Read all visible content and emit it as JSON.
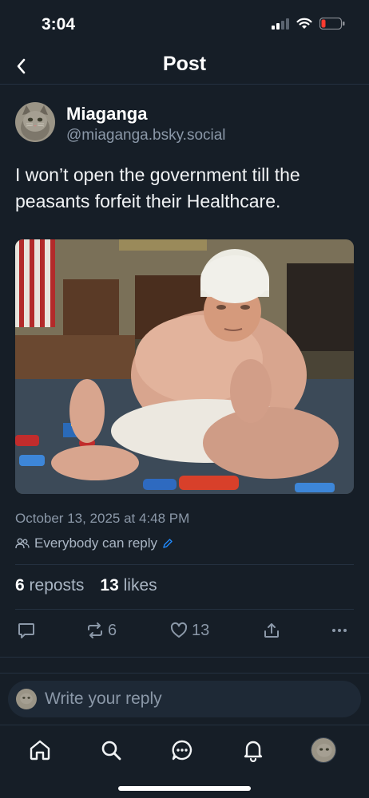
{
  "status_bar": {
    "time": "3:04"
  },
  "header": {
    "title": "Post"
  },
  "author": {
    "display_name": "Miaganga",
    "handle": "@miaganga.bsky.social"
  },
  "post": {
    "text": "I won’t open the government till the peasants forfeit their Healthcare.",
    "timestamp": "October 13, 2025 at 4:48 PM",
    "reply_setting": "Everybody can reply"
  },
  "stats": {
    "reposts_count": "6",
    "reposts_label": "reposts",
    "likes_count": "13",
    "likes_label": "likes"
  },
  "actions": {
    "repost_count": "6",
    "like_count": "13"
  },
  "composer": {
    "placeholder": "Write your reply"
  },
  "tabbar": {
    "items": [
      "home-icon",
      "search-icon",
      "chat-icon",
      "notifications-icon",
      "profile-avatar"
    ]
  },
  "colors": {
    "background": "#161e27",
    "accent": "#208bfe",
    "muted": "#8b98a8",
    "battery_low": "#ff3b30"
  }
}
